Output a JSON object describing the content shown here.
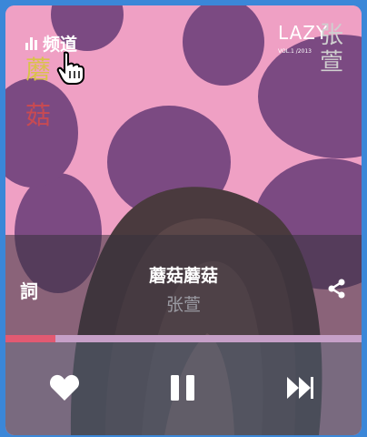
{
  "header": {
    "channel_label": "频道"
  },
  "album_art": {
    "title": "LAZY",
    "subtitle": "VOL.1 /2013",
    "artist_vertical": "张萱",
    "side_chars": [
      "蘑",
      "菇"
    ]
  },
  "now_playing": {
    "title": "蘑菇蘑菇",
    "artist": "张萱",
    "lyrics_label": "詞",
    "progress": 0.14
  },
  "controls": {
    "like_icon": "heart-icon",
    "pause_icon": "pause-icon",
    "next_icon": "fast-forward-icon",
    "share_icon": "share-icon"
  },
  "colors": {
    "frame": "#3b87d8",
    "art_background": "#efa0c4",
    "dots": "#7b4a82",
    "progress": "#e25a72"
  }
}
